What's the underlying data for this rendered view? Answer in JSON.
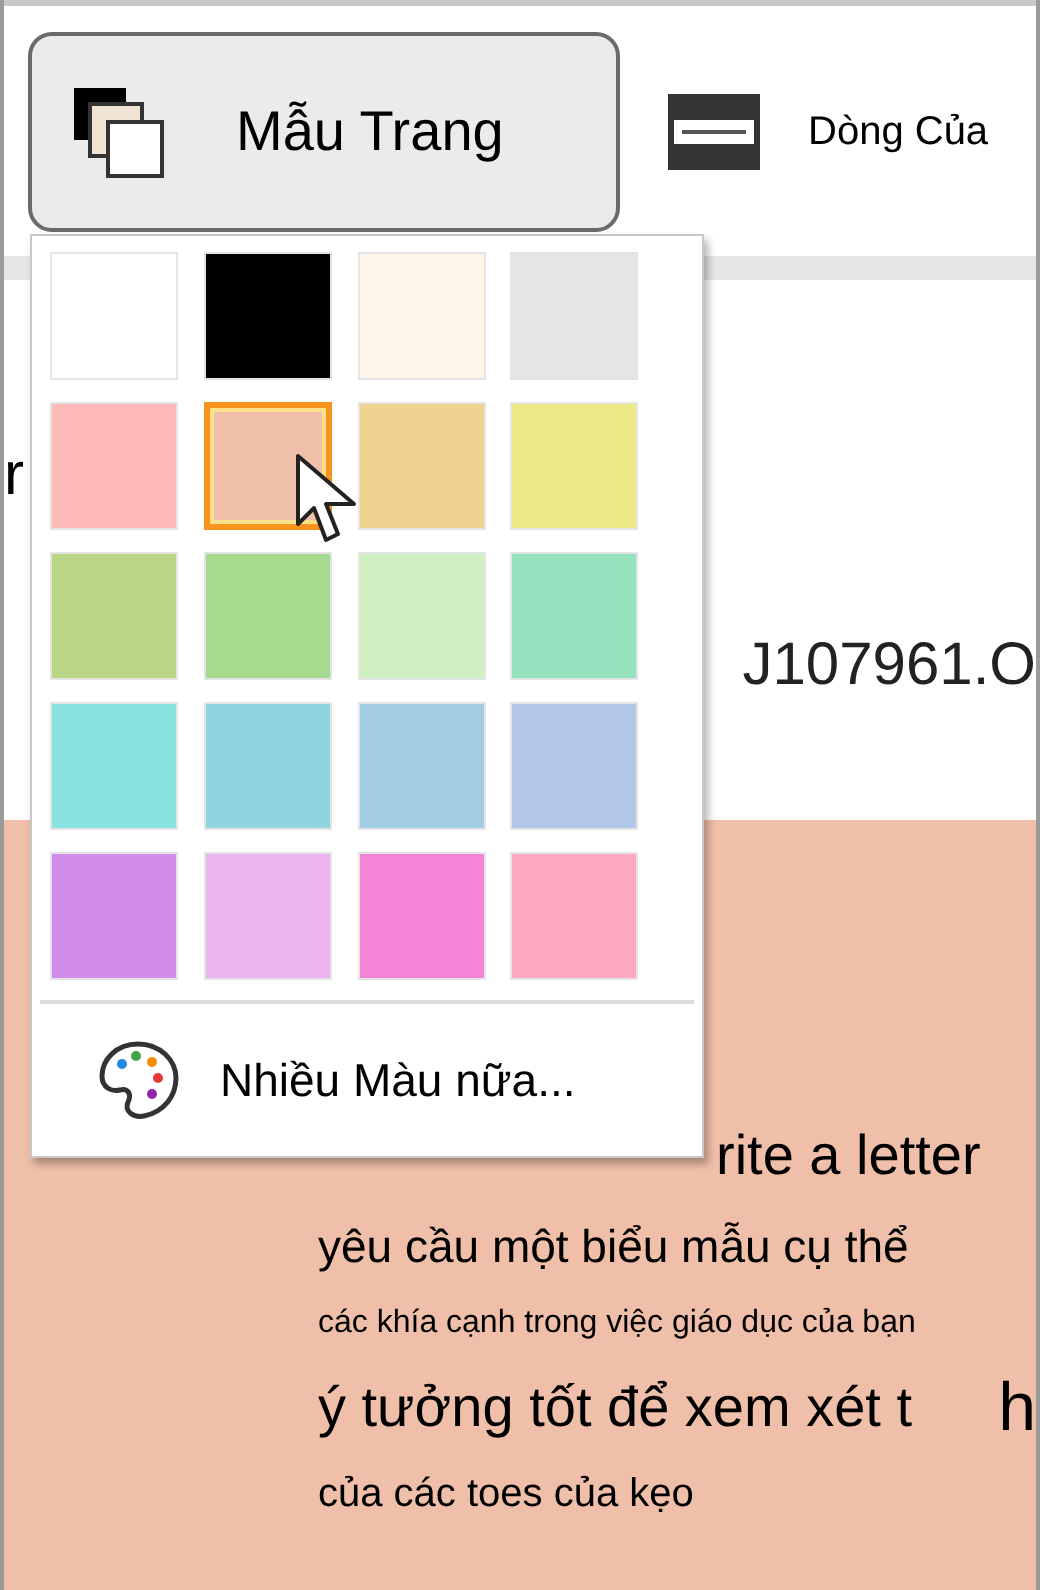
{
  "toolbar": {
    "page_color_button": {
      "label": "Mẫu Trang",
      "expanded": true
    },
    "line_focus_button": {
      "label": "Dòng Của"
    }
  },
  "color_menu": {
    "swatches": [
      {
        "color": "#ffffff",
        "selected": false
      },
      {
        "color": "#000000",
        "selected": false
      },
      {
        "color": "#fdf5e8",
        "selected": false
      },
      {
        "color": "#e6e6e6",
        "selected": false
      },
      {
        "color": "#feb9b9",
        "selected": false
      },
      {
        "color": "#f0bfa9",
        "selected": true
      },
      {
        "color": "#eed490",
        "selected": false
      },
      {
        "color": "#eae985",
        "selected": false
      },
      {
        "color": "#b9d686",
        "selected": false
      },
      {
        "color": "#a6da8e",
        "selected": false
      },
      {
        "color": "#d1f0c1",
        "selected": false
      },
      {
        "color": "#95e2bd",
        "selected": false
      },
      {
        "color": "#8ae2de",
        "selected": false
      },
      {
        "color": "#90d4df",
        "selected": false
      },
      {
        "color": "#a3cde3",
        "selected": false
      },
      {
        "color": "#b3c7ea",
        "selected": false
      },
      {
        "color": "#d08ce8",
        "selected": false
      },
      {
        "color": "#ecb6f2",
        "selected": false
      },
      {
        "color": "#f586d7",
        "selected": false
      },
      {
        "color": "#fba8c0",
        "selected": false
      }
    ],
    "more_colors": "Nhiều Màu nữa..."
  },
  "document": {
    "left_fragment": "r",
    "file_name": "J107961.O",
    "lines": [
      {
        "text": "rite a letter"
      },
      {
        "text": "yêu cầu một biểu mẫu cụ thể"
      },
      {
        "text": "các khía cạnh trong việc giáo dục của bạn"
      },
      {
        "text": "ý tưởng tốt để xem xét t",
        "tail": "h"
      },
      {
        "text": "của các toes của kẹo"
      }
    ]
  }
}
